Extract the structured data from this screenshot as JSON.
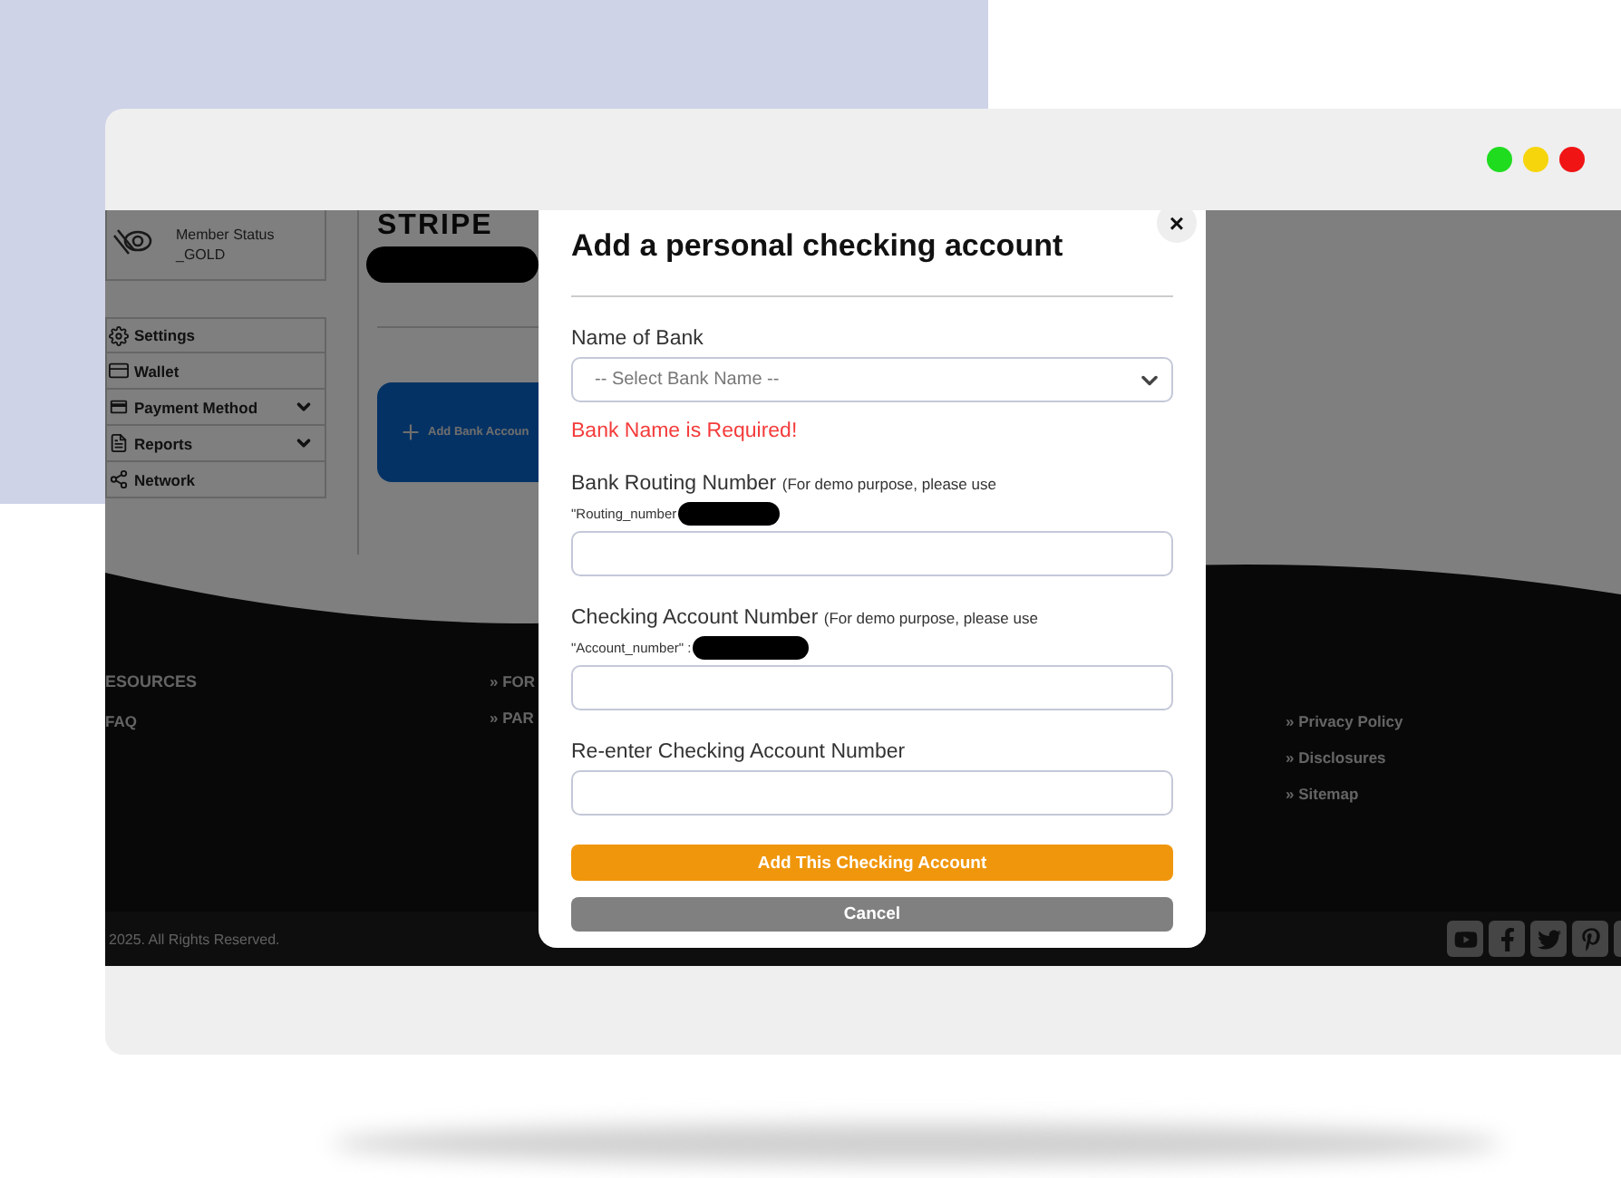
{
  "window": {
    "controls": [
      {
        "color": "#1fdc1f"
      },
      {
        "color": "#f6d50c"
      },
      {
        "color": "#f01414"
      }
    ]
  },
  "page": {
    "sidebar": {
      "member": {
        "label": "Member Status",
        "value": "_GOLD"
      },
      "items": [
        {
          "label": "Settings",
          "expandable": false
        },
        {
          "label": "Wallet",
          "expandable": false
        },
        {
          "label": "Payment Method",
          "expandable": true
        },
        {
          "label": "Reports",
          "expandable": true
        },
        {
          "label": "Network",
          "expandable": false
        }
      ]
    },
    "main": {
      "heading": "STRIPE",
      "card": "Add Bank Accoun"
    },
    "footer": {
      "columns": [
        {
          "heading": "ESOURCES",
          "links": [
            "FAQ"
          ]
        },
        {
          "links": [
            "» FOR",
            "» PAR"
          ]
        },
        {
          "links": [
            "» Privacy Policy",
            "» Disclosures",
            "» Sitemap"
          ]
        }
      ],
      "copyright": "2025. All Rights Reserved."
    }
  },
  "modal": {
    "title": "Add a personal checking account",
    "close": "×",
    "fields": [
      {
        "kind": "select",
        "label": "Name of Bank",
        "placeholder": "-- Select Bank Name --",
        "error": "Bank Name is Required!"
      },
      {
        "kind": "input",
        "label": "Bank Routing Number",
        "note": "(For demo purpose, please use",
        "hint": "\"Routing_number"
      },
      {
        "kind": "input",
        "label": "Checking Account Number",
        "note": "(For demo purpose, please use",
        "hint": "\"Account_number\" :"
      },
      {
        "kind": "input",
        "label": "Re-enter Checking Account Number"
      }
    ],
    "buttons": [
      {
        "kind": "primary",
        "label": "Add This Checking Account"
      },
      {
        "kind": "secondary",
        "label": "Cancel"
      }
    ]
  }
}
